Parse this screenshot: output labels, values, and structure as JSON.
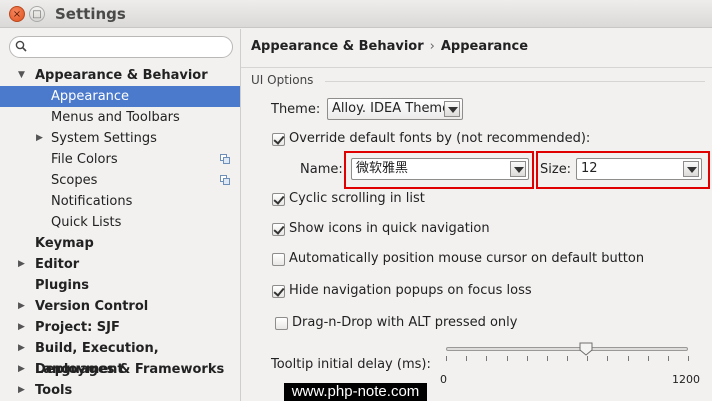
{
  "window": {
    "title": "Settings",
    "close_glyph": "×",
    "min_glyph": "□"
  },
  "sidebar": {
    "search_placeholder": "",
    "items": [
      {
        "label": "Appearance & Behavior"
      },
      {
        "label": "Appearance"
      },
      {
        "label": "Menus and Toolbars"
      },
      {
        "label": "System Settings"
      },
      {
        "label": "File Colors"
      },
      {
        "label": "Scopes"
      },
      {
        "label": "Notifications"
      },
      {
        "label": "Quick Lists"
      },
      {
        "label": "Keymap"
      },
      {
        "label": "Editor"
      },
      {
        "label": "Plugins"
      },
      {
        "label": "Version Control"
      },
      {
        "label": "Project: SJF"
      },
      {
        "label": "Build, Execution, Deployment"
      },
      {
        "label": "Languages & Frameworks"
      },
      {
        "label": "Tools"
      }
    ]
  },
  "breadcrumb": {
    "parent": "Appearance & Behavior",
    "separator": "›",
    "current": "Appearance"
  },
  "ui_options": {
    "section_title": "UI Options",
    "theme_label": "Theme:",
    "theme_value": "Alloy. IDEA Theme",
    "override_fonts_label": "Override default fonts by (not recommended):",
    "override_fonts_checked": true,
    "name_label": "Name:",
    "name_value": "微软雅黑",
    "size_label": "Size:",
    "size_value": "12",
    "options": [
      {
        "label": "Cyclic scrolling in list",
        "checked": true
      },
      {
        "label": "Show icons in quick navigation",
        "checked": true
      },
      {
        "label": "Automatically position mouse cursor on default button",
        "checked": false
      },
      {
        "label": "Hide navigation popups on focus loss",
        "checked": true
      },
      {
        "label": "Drag-n-Drop with ALT pressed only",
        "checked": false
      }
    ],
    "tooltip_label": "Tooltip initial delay (ms):",
    "tooltip_min": "0",
    "tooltip_max": "1200",
    "tooltip_value": 0.58
  },
  "watermark": "www.php-note.com",
  "colors": {
    "selection": "#4b79cc",
    "highlight_box": "#e00000"
  }
}
